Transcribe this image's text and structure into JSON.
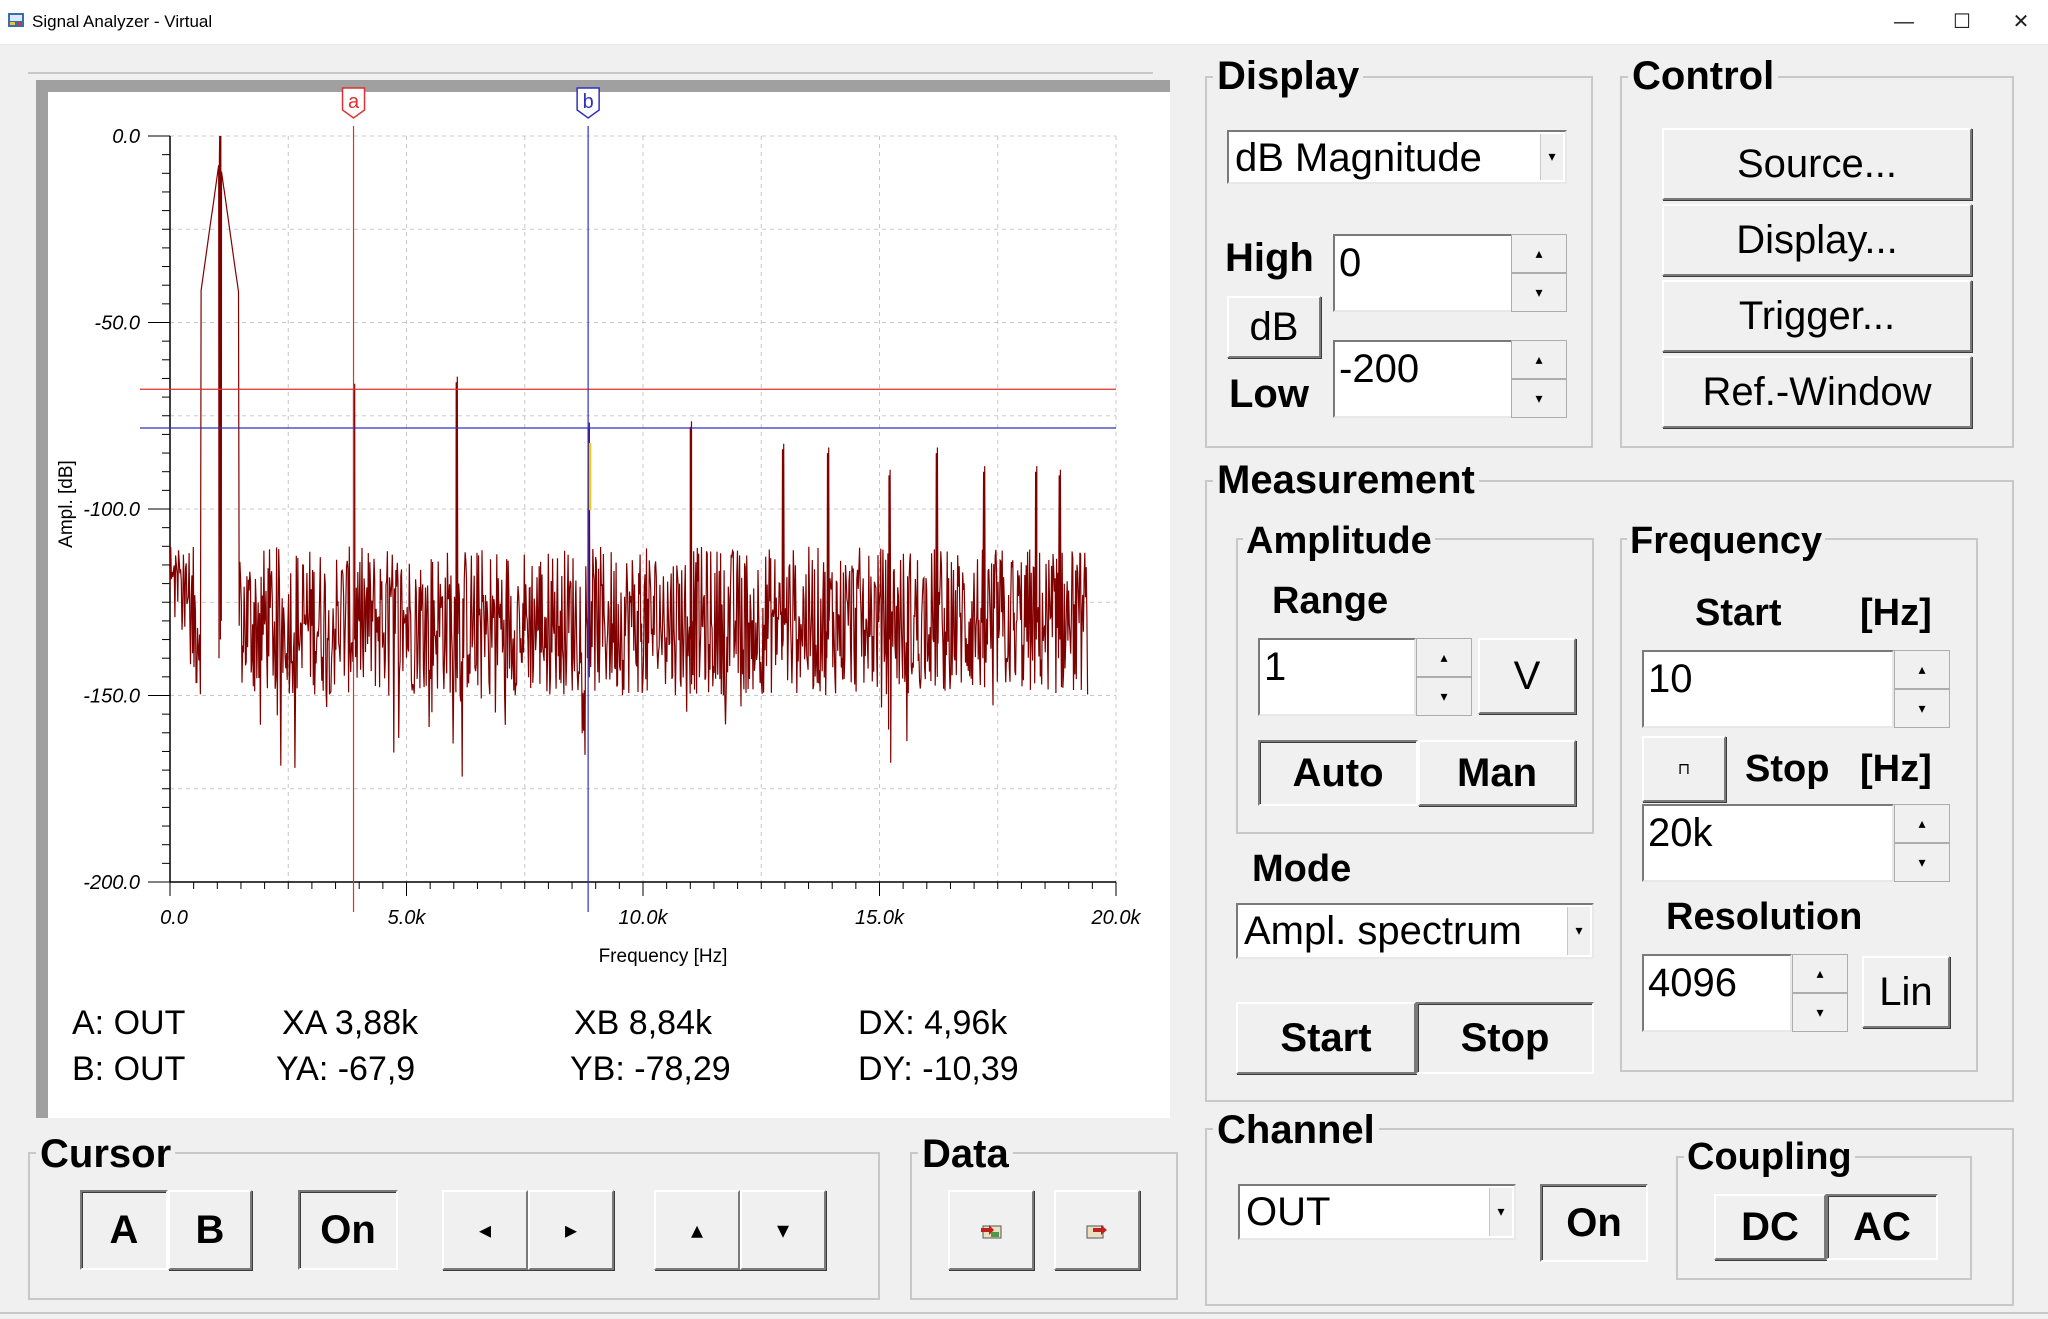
{
  "window": {
    "title": "Signal Analyzer - Virtual",
    "icon": "app-icon",
    "min": "—",
    "max": "☐",
    "close": "✕"
  },
  "chart_data": {
    "type": "line",
    "xlabel": "Frequency [Hz]",
    "ylabel": "Ampl. [dB]",
    "xlim": [
      0,
      20000
    ],
    "ylim": [
      -200,
      0
    ],
    "x_ticks": [
      "0.0",
      "5.0k",
      "10.0k",
      "15.0k",
      "20.0k"
    ],
    "y_ticks": [
      "0.0",
      "-50.0",
      "-100.0",
      "-150.0",
      "-200.0"
    ],
    "grid": true,
    "series_color": "#800000",
    "noise_floor_db": -130,
    "noise_range_hz": [
      0,
      19400
    ],
    "peaks": [
      {
        "x": 1050,
        "y": 0
      },
      {
        "x": 3880,
        "y": -67.9
      },
      {
        "x": 6050,
        "y": -66
      },
      {
        "x": 8840,
        "y": -78.3
      },
      {
        "x": 11000,
        "y": -78
      },
      {
        "x": 12950,
        "y": -84
      },
      {
        "x": 13900,
        "y": -85
      },
      {
        "x": 15200,
        "y": -91
      },
      {
        "x": 16200,
        "y": -85
      },
      {
        "x": 17200,
        "y": -90
      },
      {
        "x": 18300,
        "y": -90
      },
      {
        "x": 18800,
        "y": -91
      }
    ],
    "cursors": [
      {
        "name": "a",
        "x": 3880,
        "y": -67.9,
        "color": "#e03030"
      },
      {
        "name": "b",
        "x": 8840,
        "y": -78.29,
        "color": "#3030c0"
      }
    ]
  },
  "readouts": {
    "a_channel": "A: OUT",
    "b_channel": "B: OUT",
    "xa": "XA 3,88k",
    "ya": "YA: -67,9",
    "xb": "XB 8,84k",
    "yb": "YB: -78,29",
    "dx": "DX: 4,96k",
    "dy": "DY:  -10,39"
  },
  "display": {
    "label": "Display",
    "mode_selected": "dB Magnitude",
    "high_label": "High",
    "high_value": "0",
    "unit_button": "dB",
    "low_label": "Low",
    "low_value": "-200"
  },
  "control": {
    "label": "Control",
    "source": "Source...",
    "display": "Display...",
    "trigger": "Trigger...",
    "ref_window": "Ref.-Window"
  },
  "measurement": {
    "label": "Measurement",
    "amplitude": {
      "label": "Amplitude",
      "range_label": "Range",
      "range_value": "1",
      "unit": "V",
      "auto": "Auto",
      "man": "Man"
    },
    "mode": {
      "label": "Mode",
      "selected": "Ampl. spectrum"
    },
    "start": "Start",
    "stop": "Stop",
    "frequency": {
      "label": "Frequency",
      "start_label": "Start",
      "hz": "[Hz]",
      "start_value": "10",
      "stop_label": "Stop",
      "stop_value": "20k",
      "resolution_label": "Resolution",
      "resolution_value": "4096",
      "scale": "Lin"
    }
  },
  "cursor": {
    "label": "Cursor",
    "a": "A",
    "b": "B",
    "on": "On",
    "left": "◂",
    "right": "▸",
    "up": "▴",
    "down": "▾"
  },
  "data": {
    "label": "Data"
  },
  "channel": {
    "label": "Channel",
    "selected": "OUT",
    "on": "On"
  },
  "coupling": {
    "label": "Coupling",
    "dc": "DC",
    "ac": "AC"
  }
}
